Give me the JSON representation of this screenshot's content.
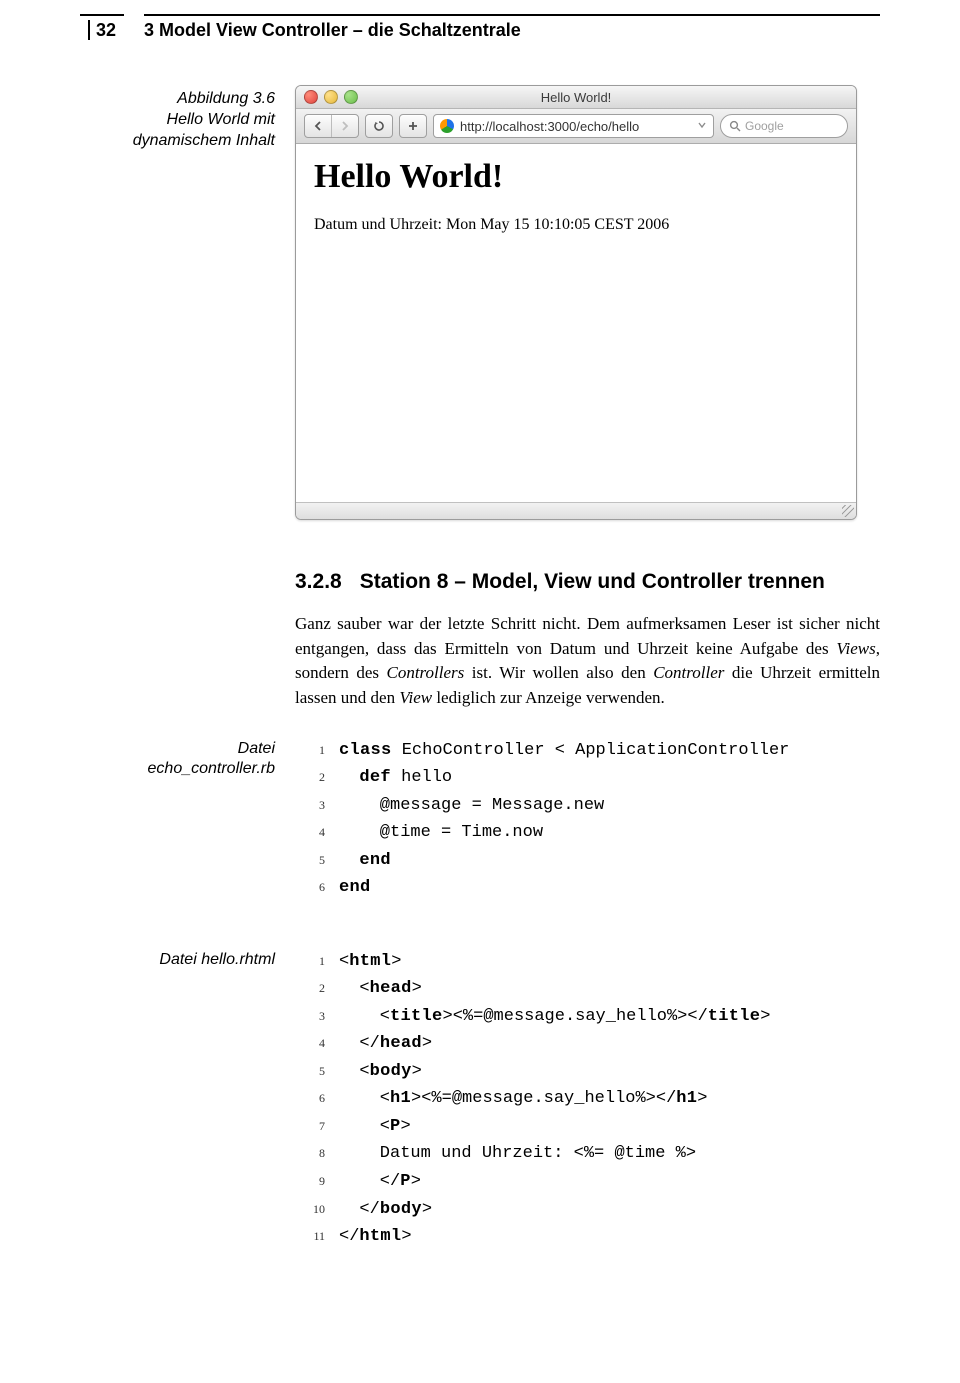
{
  "header": {
    "page_number": "32",
    "chapter_title": "3 Model View Controller – die Schaltzentrale"
  },
  "figure": {
    "caption_line1": "Abbildung 3.6",
    "caption_line2": "Hello World mit",
    "caption_line3": "dynamischem Inhalt"
  },
  "browser": {
    "window_title": "Hello World!",
    "url": "http://localhost:3000/echo/hello",
    "search_placeholder": "Google",
    "rss_label": "^",
    "page_h1": "Hello World!",
    "page_text": "Datum und Uhrzeit: Mon May 15 10:10:05 CEST 2006"
  },
  "section": {
    "number": "3.2.8",
    "title": "Station 8 – Model, View und Controller trennen",
    "paragraph_pre": "Ganz sauber war der letzte Schritt nicht. Dem aufmerksamen Leser ist sicher nicht entgangen, dass das Ermitteln von Datum und Uhrzeit keine Aufgabe des ",
    "views_em": "Views",
    "paragraph_mid1": ", sondern des ",
    "controllers_em": "Controllers",
    "paragraph_mid2": " ist. Wir wollen also den ",
    "controller_em": "Controller",
    "paragraph_mid3": " die Uhrzeit ermitteln lassen und den ",
    "view_em": "View",
    "paragraph_post": " lediglich zur Anzeige verwenden."
  },
  "listing1": {
    "label_line1": "Datei",
    "label_line2": "echo_controller.rb",
    "lines": {
      "l1_kw": "class",
      "l1_rest": " EchoController < ApplicationController",
      "l2_kw": "def",
      "l2_rest": " hello",
      "l3": "    @message = Message.new",
      "l4": "    @time = Time.now",
      "l5_kw": "end",
      "l6_kw": "end"
    }
  },
  "listing2": {
    "label": "Datei hello.rhtml",
    "lines": {
      "l1_a": "<",
      "l1_tag": "html",
      "l1_b": ">",
      "l2_a": "  <",
      "l2_tag": "head",
      "l2_b": ">",
      "l3_a": "    <",
      "l3_t1": "title",
      "l3_b": "><%=@message.say_hello%></",
      "l3_t2": "title",
      "l3_c": ">",
      "l4_a": "  </",
      "l4_tag": "head",
      "l4_b": ">",
      "l5_a": "  <",
      "l5_tag": "body",
      "l5_b": ">",
      "l6_a": "    <",
      "l6_t1": "h1",
      "l6_b": "><%=@message.say_hello%></",
      "l6_t2": "h1",
      "l6_c": ">",
      "l7_a": "    <",
      "l7_tag": "P",
      "l7_b": ">",
      "l8": "    Datum und Uhrzeit: <%= @time %>",
      "l9_a": "    </",
      "l9_tag": "P",
      "l9_b": ">",
      "l10_a": "  </",
      "l10_tag": "body",
      "l10_b": ">",
      "l11_a": "</",
      "l11_tag": "html",
      "l11_b": ">"
    }
  }
}
